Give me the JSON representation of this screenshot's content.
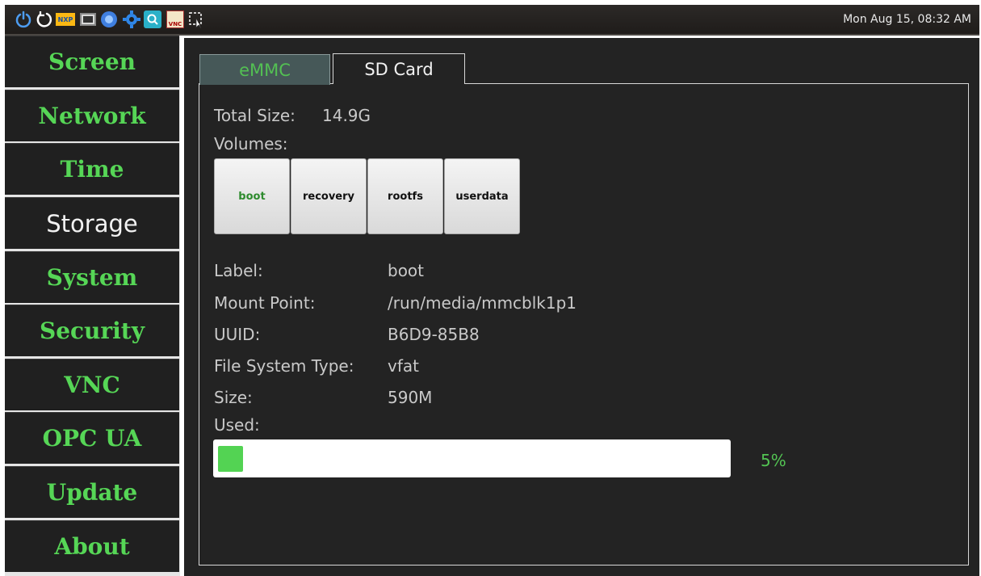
{
  "taskbar": {
    "icons": [
      "power-icon",
      "restart-icon",
      "nxp-logo-icon",
      "terminal-icon",
      "browser-icon",
      "settings-gear-icon",
      "search-app-icon",
      "tight-vnc-icon",
      "screenshot-select-icon"
    ],
    "nxp_text": "NXP",
    "vnc_text": "VNC",
    "clock": "Mon Aug 15, 08:32 AM"
  },
  "sidebar": {
    "items": [
      {
        "label": "Screen"
      },
      {
        "label": "Network"
      },
      {
        "label": "Time"
      },
      {
        "label": "Storage",
        "active": true
      },
      {
        "label": "System"
      },
      {
        "label": "Security"
      },
      {
        "label": "VNC"
      },
      {
        "label": "OPC UA"
      },
      {
        "label": "Update"
      },
      {
        "label": "About"
      }
    ]
  },
  "tabs": [
    {
      "label": "eMMC"
    },
    {
      "label": "SD Card",
      "active": true
    }
  ],
  "storage": {
    "total_size_label": "Total Size:",
    "total_size_value": "14.9G",
    "volumes_label": "Volumes:",
    "volumes": [
      {
        "label": "boot",
        "selected": true
      },
      {
        "label": "recovery"
      },
      {
        "label": "rootfs"
      },
      {
        "label": "userdata"
      }
    ],
    "details": {
      "label_key": "Label:",
      "label_value": "boot",
      "mount_key": "Mount Point:",
      "mount_value": "/run/media/mmcblk1p1",
      "uuid_key": "UUID:",
      "uuid_value": "B6D9-85B8",
      "fstype_key": "File System Type:",
      "fstype_value": "vfat",
      "size_key": "Size:",
      "size_value": "590M",
      "used_key": "Used:"
    },
    "used_percent": 5,
    "used_percent_text": "5%"
  },
  "colors": {
    "accent_green": "#56d656",
    "background": "#232323",
    "tab_inactive": "#465858"
  }
}
